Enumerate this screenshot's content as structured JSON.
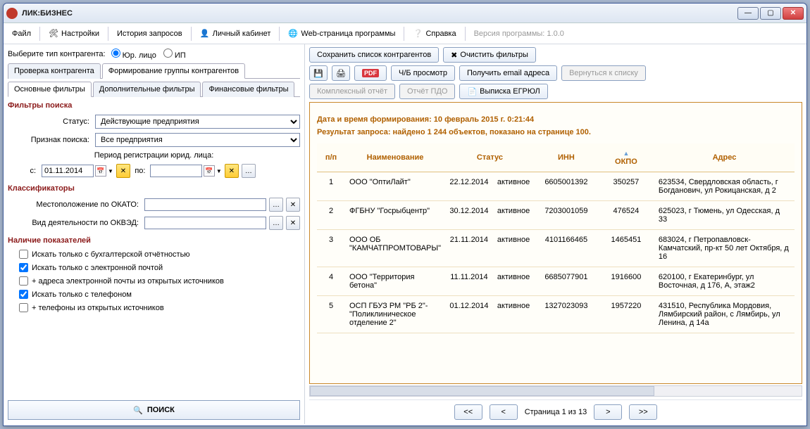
{
  "window": {
    "title": "ЛИК:БИЗНЕС"
  },
  "menu": {
    "file": "Файл",
    "settings": "Настройки",
    "history": "История запросов",
    "account": "Личный кабинет",
    "webpage": "Web-страница программы",
    "help": "Справка",
    "version": "Версия программы: 1.0.0"
  },
  "subbar": {
    "choose_type": "Выберите тип контрагента:",
    "legal": "Юр. лицо",
    "ip": "ИП",
    "save_list": "Сохранить список контрагентов",
    "clear_filters": "Очистить фильтры"
  },
  "left": {
    "tab_check": "Проверка контрагента",
    "tab_group": "Формирование группы контрагентов",
    "sub_main": "Основные фильтры",
    "sub_extra": "Дополнительные фильтры",
    "sub_fin": "Финансовые фильтры",
    "sec_search": "Фильтры поиска",
    "status_label": "Статус:",
    "status_value": "Действующие предприятия",
    "sign_label": "Признак поиска:",
    "sign_value": "Все предприятия",
    "period_label": "Период регистрации юрид. лица:",
    "from_label": "с:",
    "from_value": "01.11.2014",
    "to_label": "по:",
    "sec_class": "Классификаторы",
    "okato_label": "Местоположение по ОКАТО:",
    "okved_label": "Вид деятельности по ОКВЭД:",
    "sec_ind": "Наличие показателей",
    "chk1": "Искать только с бухгалтерской отчётностью",
    "chk2": "Искать только с электронной почтой",
    "chk3": "+ адреса электронной почты из открытых источников",
    "chk4": "Искать только с телефоном",
    "chk5": "+ телефоны из открытых источников",
    "search_btn": "ПОИСК"
  },
  "right": {
    "pdf": "PDF",
    "bw": "Ч/Б просмотр",
    "emails": "Получить email адреса",
    "back": "Вернуться к списку",
    "complex": "Комплексный отчёт",
    "pdo": "Отчёт ПДО",
    "egrul": "Выписка ЕГРЮЛ"
  },
  "report": {
    "date_line": "Дата и время формирования: 10 февраль 2015 г. 0:21:44",
    "result_line": "Результат запроса: найдено 1 244 объектов, показано на странице 100.",
    "cols": {
      "pp": "п/п",
      "name": "Наименование",
      "status": "Статус",
      "inn": "ИНН",
      "okpo": "ОКПО",
      "addr": "Адрес"
    },
    "rows": [
      {
        "n": "1",
        "name": "ООО \"ОптиЛайт\"",
        "date": "22.12.2014",
        "status": "активное",
        "inn": "6605001392",
        "okpo": "350257",
        "addr": "623534, Свердловская область, г Богданович, ул Рокицанская, д 2"
      },
      {
        "n": "2",
        "name": "ФГБНУ \"Госрыбцентр\"",
        "date": "30.12.2014",
        "status": "активное",
        "inn": "7203001059",
        "okpo": "476524",
        "addr": "625023, г Тюмень, ул Одесская, д 33"
      },
      {
        "n": "3",
        "name": "ООО ОБ \"КАМЧАТПРОМТОВАРЫ\"",
        "date": "21.11.2014",
        "status": "активное",
        "inn": "4101166465",
        "okpo": "1465451",
        "addr": "683024, г Петропавловск-Камчатский, пр-кт 50 лет Октября, д 16"
      },
      {
        "n": "4",
        "name": "ООО \"Территория бетона\"",
        "date": "11.11.2014",
        "status": "активное",
        "inn": "6685077901",
        "okpo": "1916600",
        "addr": "620100, г Екатеринбург, ул Восточная, д 176, А, этаж2"
      },
      {
        "n": "5",
        "name": "ОСП ГБУЗ РМ \"РБ  2\"-\"Поликлиническое отделение  2\"",
        "date": "01.12.2014",
        "status": "активное",
        "inn": "1327023093",
        "okpo": "1957220",
        "addr": "431510, Республика Мордовия, Лямбирский район, с Лямбирь, ул Ленина, д 14а"
      }
    ]
  },
  "pager": {
    "first": "<<",
    "prev": "<",
    "next": ">",
    "last": ">>",
    "text": "Страница 1 из 13"
  }
}
